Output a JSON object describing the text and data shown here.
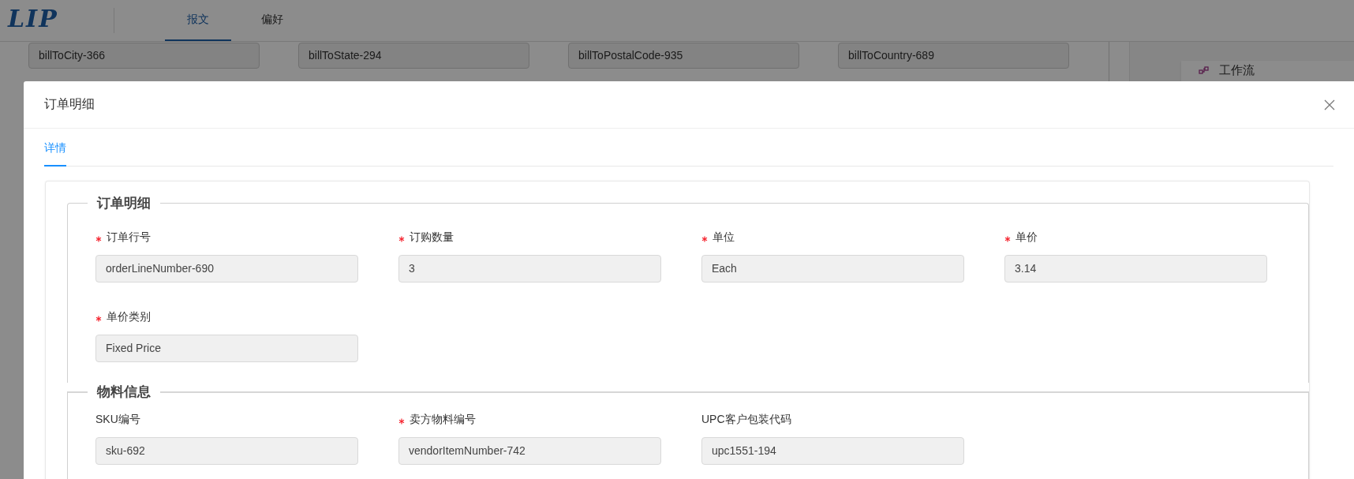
{
  "header": {
    "logo": "LIP",
    "tabs": [
      {
        "label": "报文",
        "selected": true
      },
      {
        "label": "偏好",
        "selected": false
      }
    ]
  },
  "background_fields": [
    {
      "value": "billToCity-366"
    },
    {
      "value": "billToState-294"
    },
    {
      "value": "billToPostalCode-935"
    },
    {
      "value": "billToCountry-689"
    }
  ],
  "side_panel": {
    "items": [
      {
        "label": "工作流"
      }
    ]
  },
  "dialog": {
    "title": "订单明细",
    "tabs": [
      {
        "label": "详情",
        "selected": true
      }
    ],
    "sections": [
      {
        "title": "订单明细",
        "fields": [
          {
            "label": "订单行号",
            "required": true,
            "value": "orderLineNumber-690"
          },
          {
            "label": "订购数量",
            "required": true,
            "value": "3"
          },
          {
            "label": "单位",
            "required": true,
            "value": "Each"
          },
          {
            "label": "单价",
            "required": true,
            "value": "3.14"
          },
          {
            "label": "单价类别",
            "required": true,
            "value": "Fixed Price"
          }
        ]
      },
      {
        "title": "物料信息",
        "fields": [
          {
            "label": "SKU编号",
            "required": false,
            "value": "sku-692"
          },
          {
            "label": "卖方物料编号",
            "required": true,
            "value": "vendorItemNumber-742"
          },
          {
            "label": "UPC客户包装代码",
            "required": false,
            "value": "upc1551-194"
          }
        ]
      }
    ]
  }
}
